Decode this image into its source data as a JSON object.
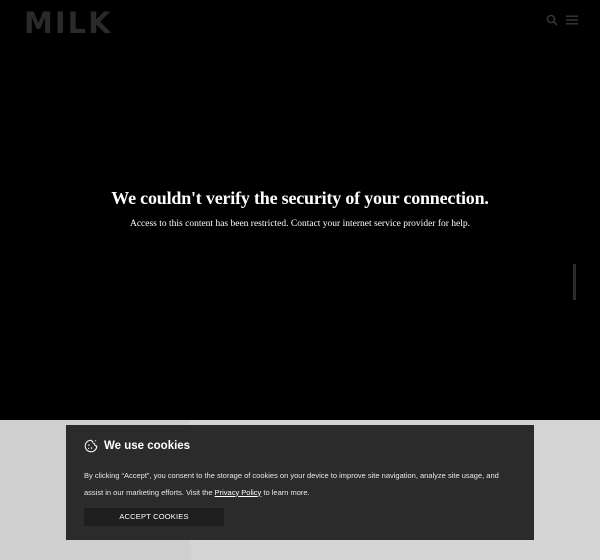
{
  "header": {
    "logo_text": "MILK",
    "icons": [
      "search-icon",
      "menu-icon"
    ]
  },
  "message": {
    "title": "We couldn't verify the security of your connection.",
    "body": "Access to this content has been restricted. Contact your internet service provider for help."
  },
  "cookie_banner": {
    "icon": "cookie-icon",
    "title": "We use cookies",
    "text_before_link": "By clicking “Accept”, you consent to the storage of cookies on your device to improve site navigation, analyze site usage, and assist in our marketing efforts. Visit the ",
    "link_text": "Privacy Policy",
    "text_after_link": " to learn more.",
    "accept_label": "ACCEPT COOKIES"
  },
  "colors": {
    "page_background": "#000000",
    "banner_background": "#2b2b2b",
    "lower_band": "#d4d4d4",
    "logo": "#2a2a2a",
    "text": "#ffffff"
  }
}
